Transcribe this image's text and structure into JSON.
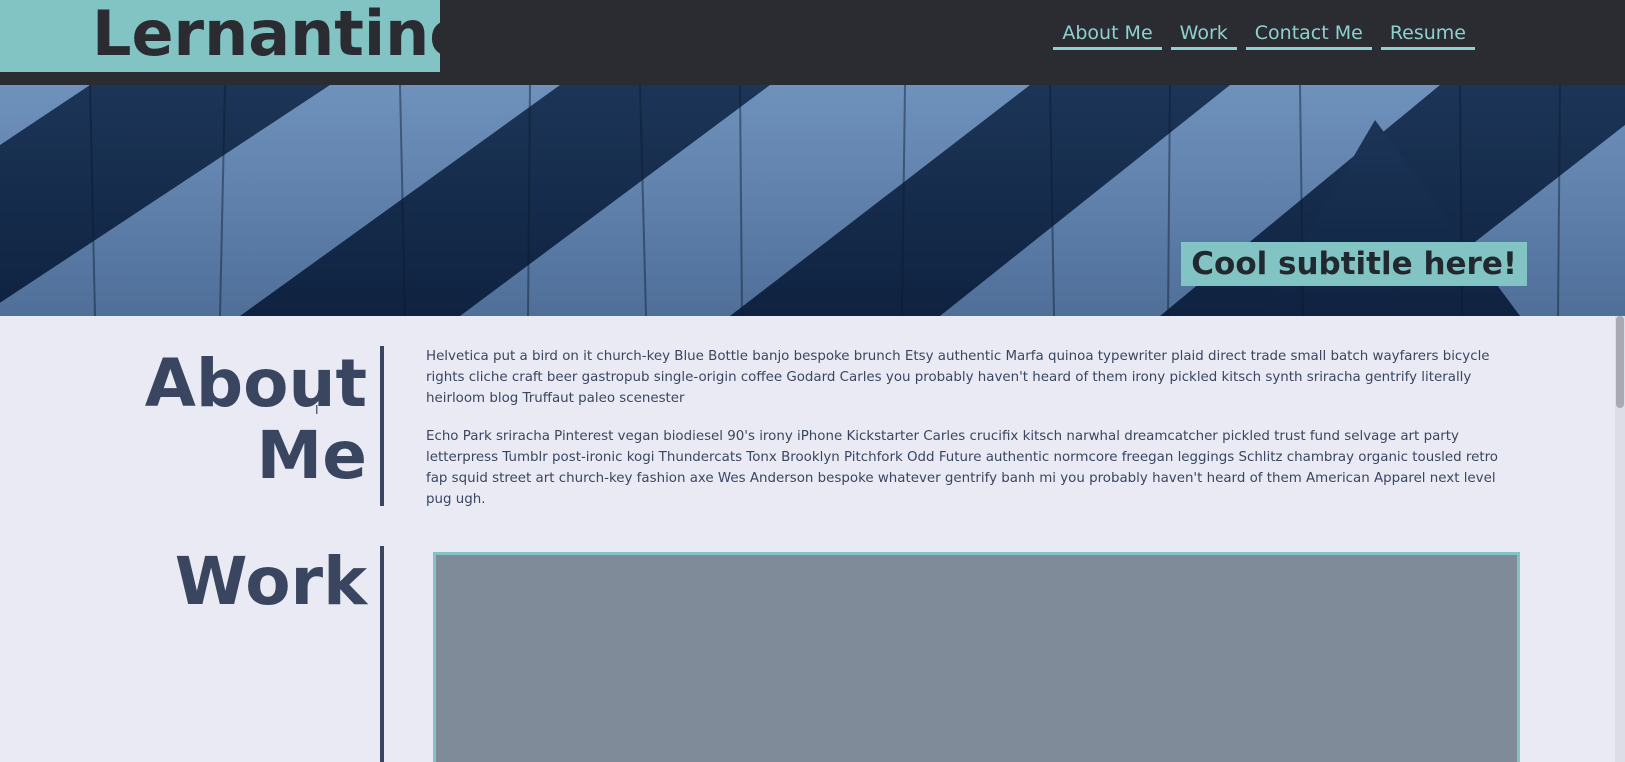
{
  "header": {
    "logo": "Lernantino",
    "nav": [
      {
        "label": "About Me"
      },
      {
        "label": "Work"
      },
      {
        "label": "Contact Me"
      },
      {
        "label": "Resume"
      }
    ]
  },
  "hero": {
    "subtitle": "Cool subtitle here!"
  },
  "about": {
    "heading_line1": "About",
    "heading_line2": "Me",
    "paragraphs": [
      "Helvetica put a bird on it church-key Blue Bottle banjo bespoke brunch Etsy authentic Marfa quinoa typewriter plaid direct trade small batch wayfarers bicycle rights cliche craft beer gastropub single-origin coffee Godard Carles you probably haven't heard of them irony pickled kitsch synth sriracha gentrify literally heirloom blog Truffaut paleo scenester",
      "Echo Park sriracha Pinterest vegan biodiesel 90's irony iPhone Kickstarter Carles crucifix kitsch narwhal dreamcatcher pickled trust fund selvage art party letterpress Tumblr post-ironic kogi Thundercats Tonx Brooklyn Pitchfork Odd Future authentic normcore freegan leggings Schlitz chambray organic tousled retro fap squid street art church-key fashion axe Wes Anderson bespoke whatever gentrify banh mi you probably haven't heard of them American Apparel next level pug ugh."
    ]
  },
  "work": {
    "heading": "Work"
  },
  "colors": {
    "header_bg": "#2a2c31",
    "accent": "#82c3c3",
    "nav_text": "#8ed1cf",
    "heading": "#3a4660",
    "page_bg": "#e9eaf4",
    "work_placeholder": "#7f8b98"
  }
}
